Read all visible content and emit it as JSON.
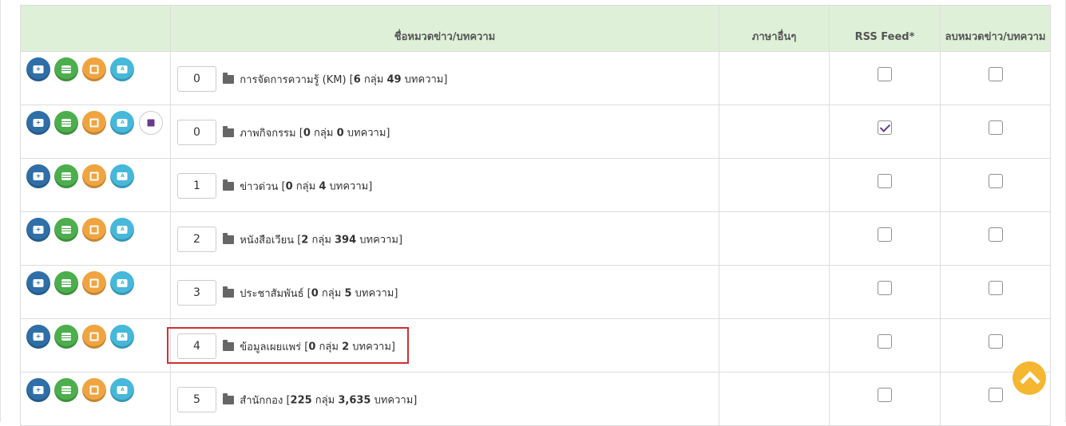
{
  "table": {
    "headers": {
      "actions": "",
      "name": "ชื่อหมวดข่าว/บทความ",
      "other_lang": "ภาษาอื่นๆ",
      "rss": "RSS Feed*",
      "delete": "ลบหมวดข่าว/บทความ"
    },
    "rows": [
      {
        "order": "0",
        "name": "การจัดการความรู้ (KM)",
        "open": "[",
        "groups": "6",
        "groups_label": " กลุ่ม ",
        "articles": "49",
        "articles_label": " บทความ]",
        "rss_checked": false,
        "has_rss_icon": false
      },
      {
        "order": "0",
        "name": "ภาพกิจกรรม",
        "open": "[",
        "groups": "0",
        "groups_label": " กลุ่ม ",
        "articles": "0",
        "articles_label": " บทความ]",
        "rss_checked": true,
        "has_rss_icon": true
      },
      {
        "order": "1",
        "name": "ข่าวด่วน",
        "open": "[",
        "groups": "0",
        "groups_label": " กลุ่ม ",
        "articles": "4",
        "articles_label": " บทความ]",
        "rss_checked": false,
        "has_rss_icon": false
      },
      {
        "order": "2",
        "name": "หนังสือเวียน",
        "open": "[",
        "groups": "2",
        "groups_label": " กลุ่ม ",
        "articles": "394",
        "articles_label": " บทความ]",
        "rss_checked": false,
        "has_rss_icon": false
      },
      {
        "order": "3",
        "name": "ประชาสัมพันธ์",
        "open": "[",
        "groups": "0",
        "groups_label": " กลุ่ม ",
        "articles": "5",
        "articles_label": " บทความ]",
        "rss_checked": false,
        "has_rss_icon": false
      },
      {
        "order": "4",
        "name": "ข้อมูลเผยแพร่",
        "open": "[",
        "groups": "0",
        "groups_label": " กลุ่ม ",
        "articles": "2",
        "articles_label": " บทความ]",
        "rss_checked": false,
        "has_rss_icon": false
      },
      {
        "order": "5",
        "name": "สำนักกอง",
        "open": "[",
        "groups": "225",
        "groups_label": " กลุ่ม ",
        "articles": "3,635",
        "articles_label": " บทความ]",
        "rss_checked": false,
        "has_rss_icon": false
      }
    ]
  },
  "icons": {
    "add": "add-subcategory-icon",
    "list": "list-articles-icon",
    "edit": "edit-icon",
    "lang": "language-icon",
    "rss": "rss-icon",
    "folder": "folder-icon",
    "scroll": "chevron-up-icon"
  },
  "colors": {
    "header_bg": "#dff0d8",
    "add": "#2f6fa8",
    "list": "#4cae4c",
    "edit": "#f0a440",
    "lang": "#46b8da",
    "highlight": "#d32f2f",
    "scroll_top": "#f5b731"
  }
}
